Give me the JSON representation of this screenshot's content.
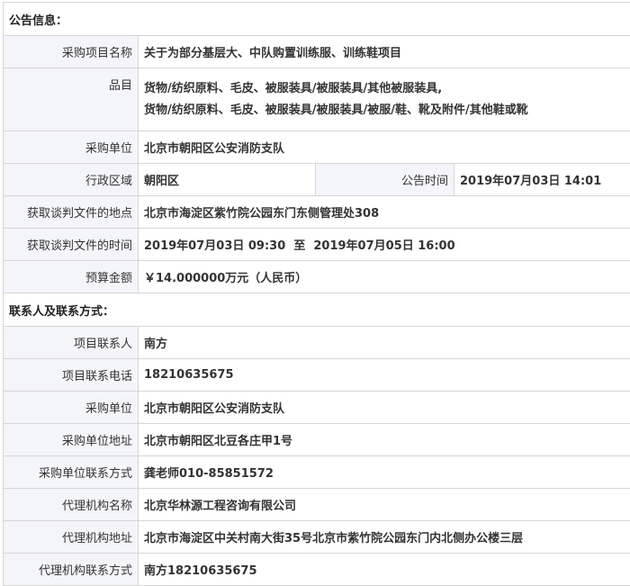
{
  "notice_section": {
    "title": "公告信息：",
    "rows": {
      "project_name": {
        "label": "采购项目名称",
        "value": "关于为部分基层大、中队购置训练服、训练鞋项目"
      },
      "items": {
        "label": "品目",
        "value_line1": "货物/纺织原料、毛皮、被服装具/被服装具/其他被服装具,",
        "value_line2": "货物/纺织原料、毛皮、被服装具/被服装具/被服/鞋、靴及附件/其他鞋或靴"
      },
      "purchaser": {
        "label": "采购单位",
        "value": "北京市朝阳区公安消防支队"
      },
      "region": {
        "label": "行政区域",
        "value": "朝阳区",
        "time_label": "公告时间",
        "time_value": "2019年07月03日 14:01"
      },
      "doc_location": {
        "label": "获取谈判文件的地点",
        "value": "北京市海淀区紫竹院公园东门东侧管理处308"
      },
      "doc_time": {
        "label": "获取谈判文件的时间",
        "value": "2019年07月03日 09:30  至  2019年07月05日 16:00"
      },
      "budget": {
        "label": "预算金额",
        "value": "￥14.000000万元（人民币）"
      }
    }
  },
  "contact_section": {
    "title": "联系人及联系方式：",
    "rows": {
      "project_contact": {
        "label": "项目联系人",
        "value": "南方"
      },
      "project_phone": {
        "label": "项目联系电话",
        "value": "18210635675"
      },
      "purchaser": {
        "label": "采购单位",
        "value": "北京市朝阳区公安消防支队"
      },
      "purchaser_address": {
        "label": "采购单位地址",
        "value": "北京市朝阳区北豆各庄甲1号"
      },
      "purchaser_contact": {
        "label": "采购单位联系方式",
        "value": "龚老师010-85851572"
      },
      "agency_name": {
        "label": "代理机构名称",
        "value": "北京华林源工程咨询有限公司"
      },
      "agency_address": {
        "label": "代理机构地址",
        "value": "北京市海淀区中关村南大街35号北京市紫竹院公园东门内北侧办公楼三层"
      },
      "agency_contact": {
        "label": "代理机构联系方式",
        "value": "南方18210635675"
      }
    }
  }
}
